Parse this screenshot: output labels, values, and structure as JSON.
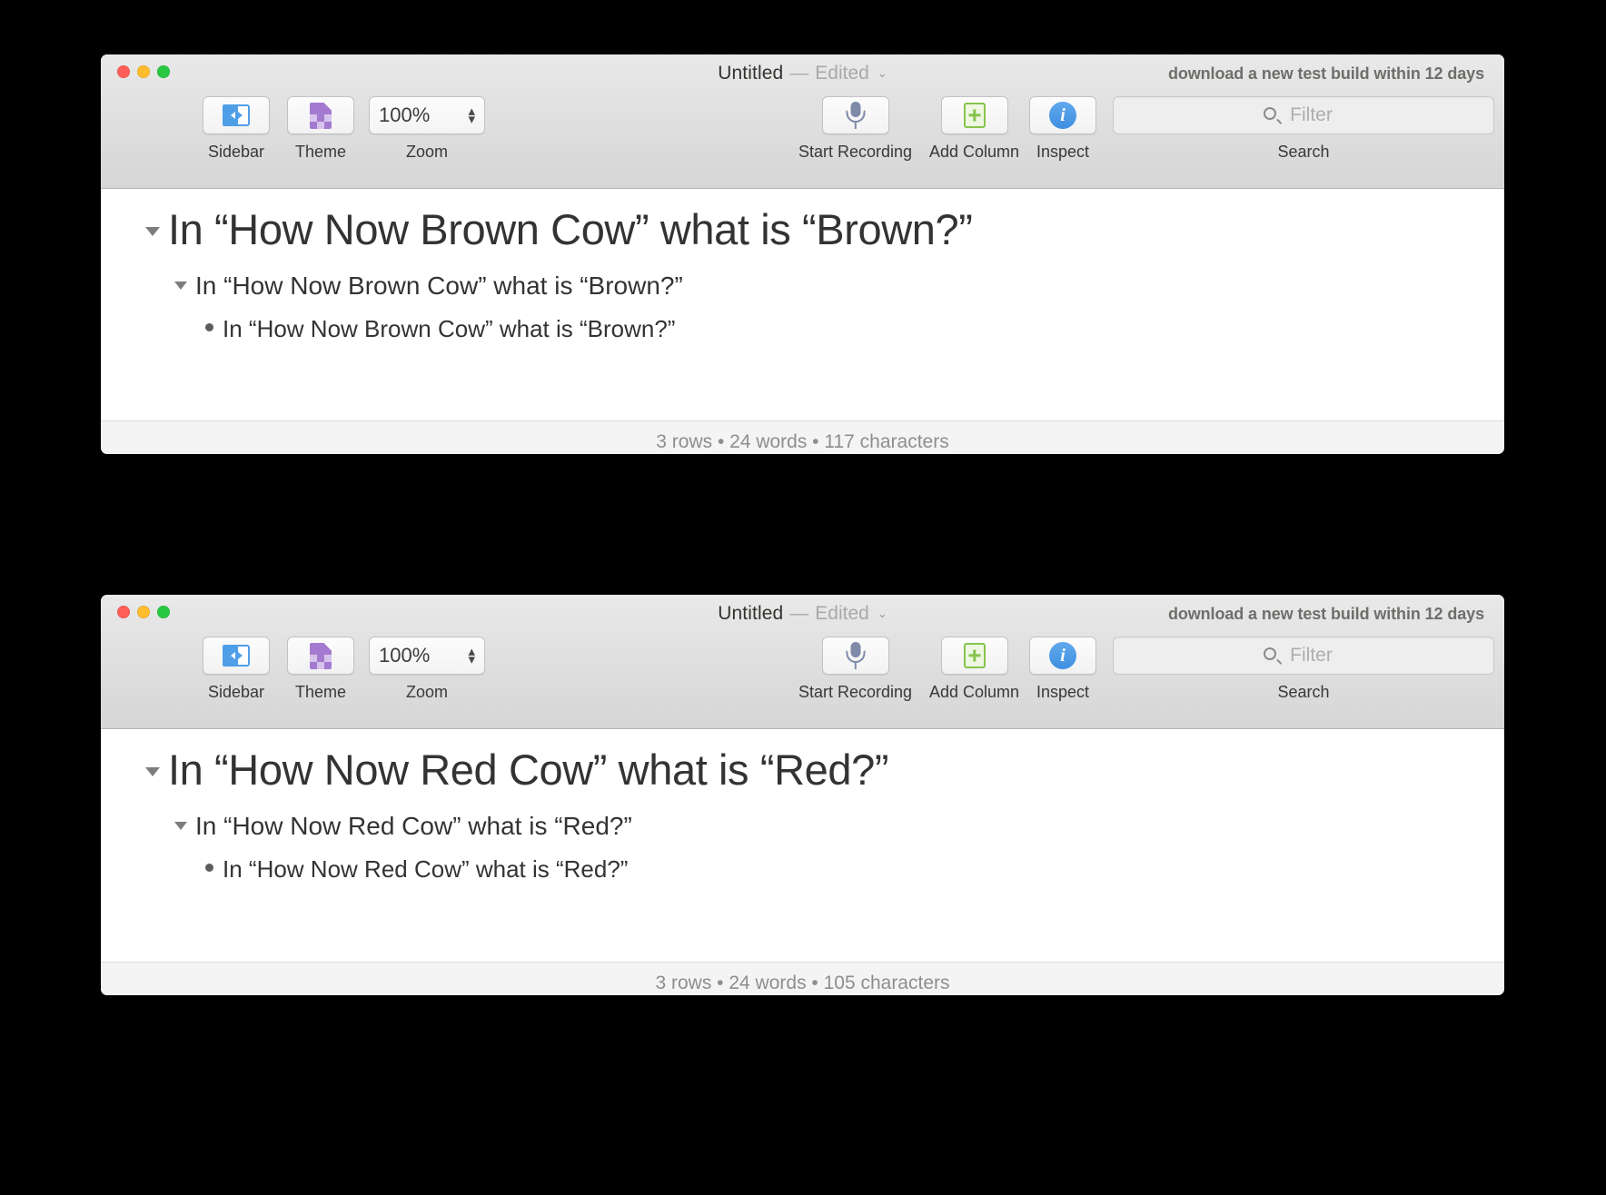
{
  "windows": [
    {
      "title": "Untitled",
      "separator": "—",
      "edited_label": "Edited",
      "chevron": "⌄",
      "build_warning": "download a new test build within 12 days",
      "toolbar": {
        "sidebar_label": "Sidebar",
        "theme_label": "Theme",
        "zoom_label": "Zoom",
        "zoom_value": "100%",
        "record_label": "Start Recording",
        "column_label": "Add Column",
        "inspect_label": "Inspect",
        "inspect_glyph": "i",
        "search_label": "Search",
        "search_placeholder": "Filter",
        "search_value": ""
      },
      "rows": [
        {
          "level": 1,
          "marker": "disclosure",
          "text": "In “How Now Brown Cow” what is “Brown?”"
        },
        {
          "level": 2,
          "marker": "disclosure",
          "text": "In “How Now Brown Cow” what is “Brown?”"
        },
        {
          "level": 3,
          "marker": "bullet",
          "text": "In “How Now Brown Cow” what is “Brown?”"
        }
      ],
      "status": "3 rows • 24 words • 117 characters"
    },
    {
      "title": "Untitled",
      "separator": "—",
      "edited_label": "Edited",
      "chevron": "⌄",
      "build_warning": "download a new test build within 12 days",
      "toolbar": {
        "sidebar_label": "Sidebar",
        "theme_label": "Theme",
        "zoom_label": "Zoom",
        "zoom_value": "100%",
        "record_label": "Start Recording",
        "column_label": "Add Column",
        "inspect_label": "Inspect",
        "inspect_glyph": "i",
        "search_label": "Search",
        "search_placeholder": "Filter",
        "search_value": ""
      },
      "rows": [
        {
          "level": 1,
          "marker": "disclosure",
          "text": "In “How Now Red Cow” what is “Red?”"
        },
        {
          "level": 2,
          "marker": "disclosure",
          "text": "In “How Now Red Cow” what is “Red?”"
        },
        {
          "level": 3,
          "marker": "bullet",
          "text": "In “How Now Red Cow” what is “Red?”"
        }
      ],
      "status": "3 rows • 24 words • 105 characters"
    }
  ],
  "colors": {
    "accent_blue": "#4f9ee8",
    "theme_purple": "#a47ad0",
    "column_green": "#86c44d",
    "info_blue": "#3d8fe0",
    "mic_gray_blue": "#7e8aa8",
    "close_red": "#ff5f57",
    "minimize_yellow": "#febc2e",
    "zoom_green": "#28c840",
    "backdrop": "#000000"
  }
}
